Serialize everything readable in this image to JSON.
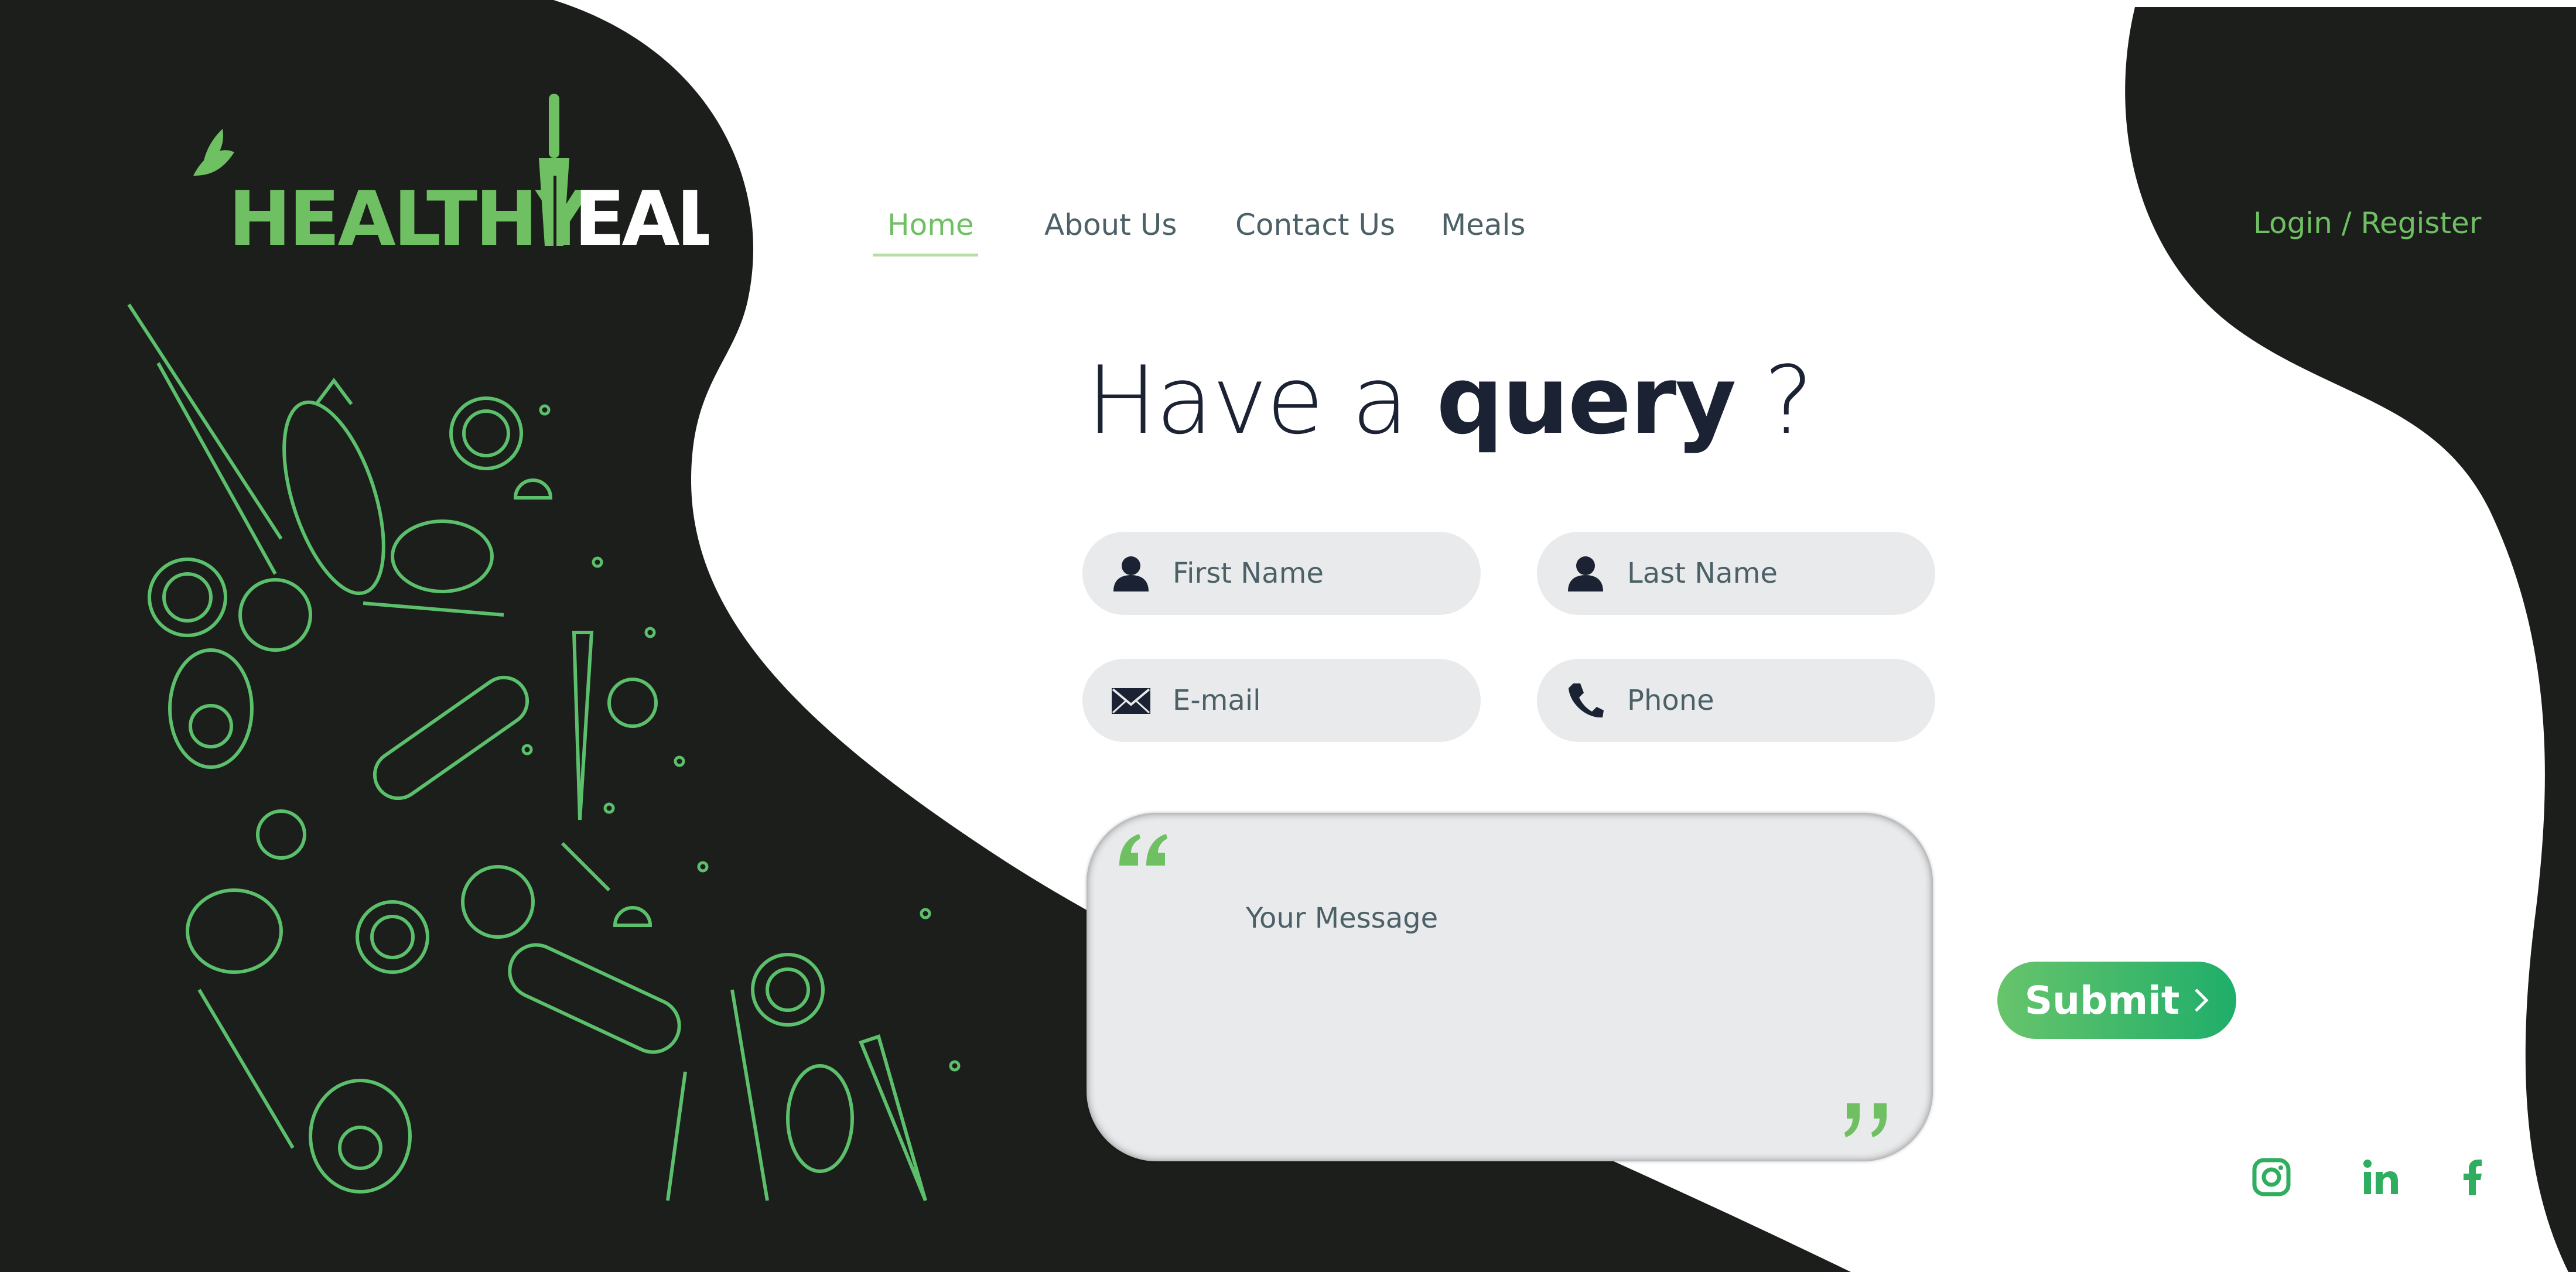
{
  "brand": {
    "logo_text_left": "HEALTHY",
    "logo_text_right": "EAL",
    "colors": {
      "green": "#6fbf63",
      "dark": "#1b1e1a",
      "white": "#ffffff"
    }
  },
  "nav": {
    "items": [
      {
        "label": "Home",
        "active": true
      },
      {
        "label": "About Us",
        "active": false
      },
      {
        "label": "Contact Us",
        "active": false
      },
      {
        "label": "Meals",
        "active": false
      }
    ],
    "login_label": "Login / Register"
  },
  "heading": {
    "prefix": "Have a ",
    "bold": "query",
    "suffix": " ?"
  },
  "form": {
    "first_name_placeholder": "First Name",
    "last_name_placeholder": "Last Name",
    "email_placeholder": "E-mail",
    "phone_placeholder": "Phone",
    "message_placeholder": "Your Message",
    "submit_label": "Submit"
  },
  "icons": {
    "first_name": "user-icon",
    "last_name": "user-icon",
    "email": "envelope-icon",
    "phone": "phone-icon",
    "social": [
      "instagram-icon",
      "linkedin-icon",
      "facebook-icon"
    ]
  }
}
